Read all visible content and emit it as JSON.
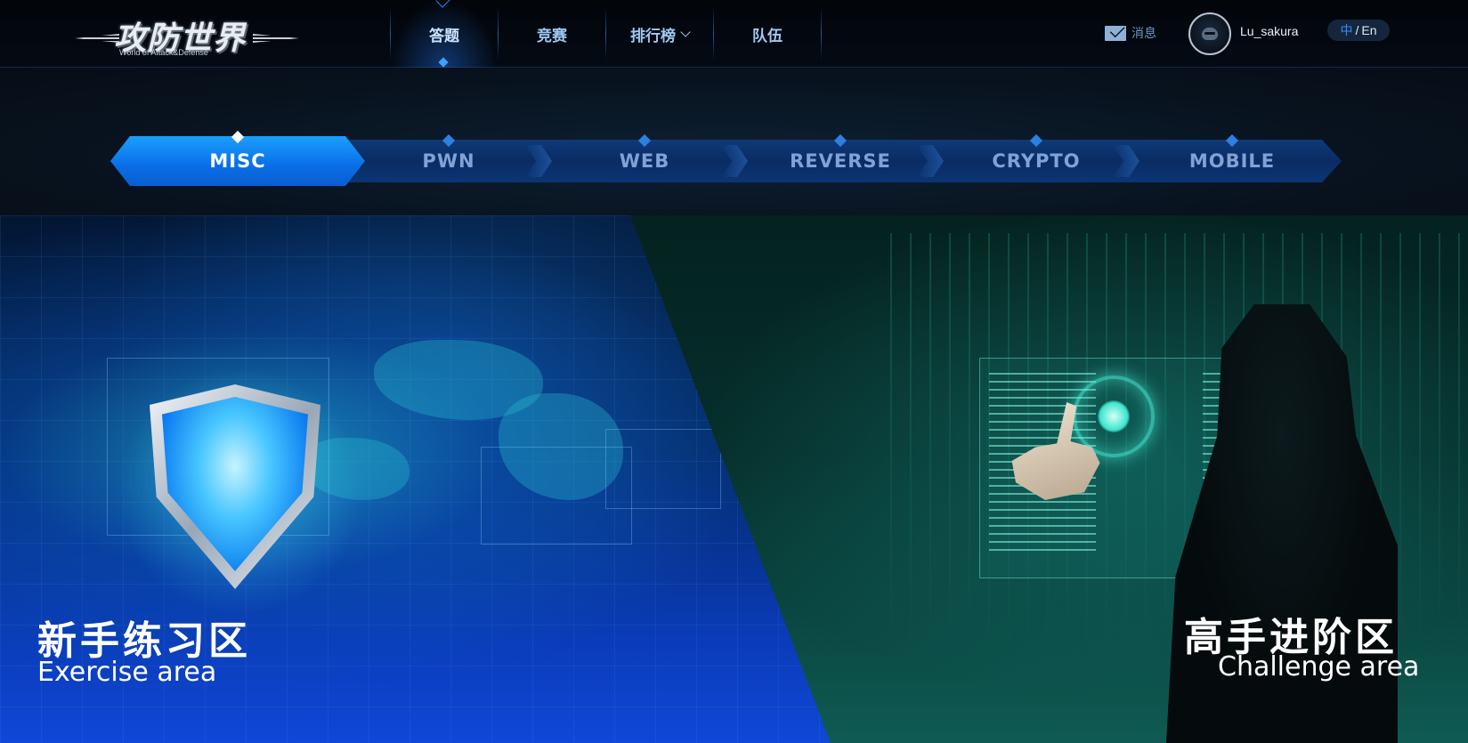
{
  "header": {
    "logo_title": "攻防世界",
    "logo_subtitle": "World of Attack&Defense",
    "nav": [
      {
        "label": "答题",
        "active": true
      },
      {
        "label": "竞赛",
        "active": false
      },
      {
        "label": "排行榜",
        "active": false,
        "dropdown": true
      },
      {
        "label": "队伍",
        "active": false
      }
    ],
    "messages_label": "消息",
    "username": "Lu_sakura",
    "lang_zh": "中",
    "lang_sep": "/",
    "lang_en": "En"
  },
  "categories": {
    "selected": "MISC",
    "items": [
      "MISC",
      "PWN",
      "WEB",
      "REVERSE",
      "CRYPTO",
      "MOBILE"
    ]
  },
  "areas": {
    "exercise": {
      "title": "新手练习区",
      "subtitle": "Exercise area"
    },
    "challenge": {
      "title": "高手进阶区",
      "subtitle": "Challenge area"
    }
  },
  "colors": {
    "accent": "#1a8cff",
    "active_tab": "#0a6ee6",
    "nav_text": "#9ec9f2",
    "exercise_bg": "#0a3bb8",
    "challenge_bg": "#0b4a45"
  },
  "icons": {
    "messages": "envelope-icon",
    "dropdown": "chevron-down-icon",
    "avatar": "ninja-avatar-icon"
  }
}
